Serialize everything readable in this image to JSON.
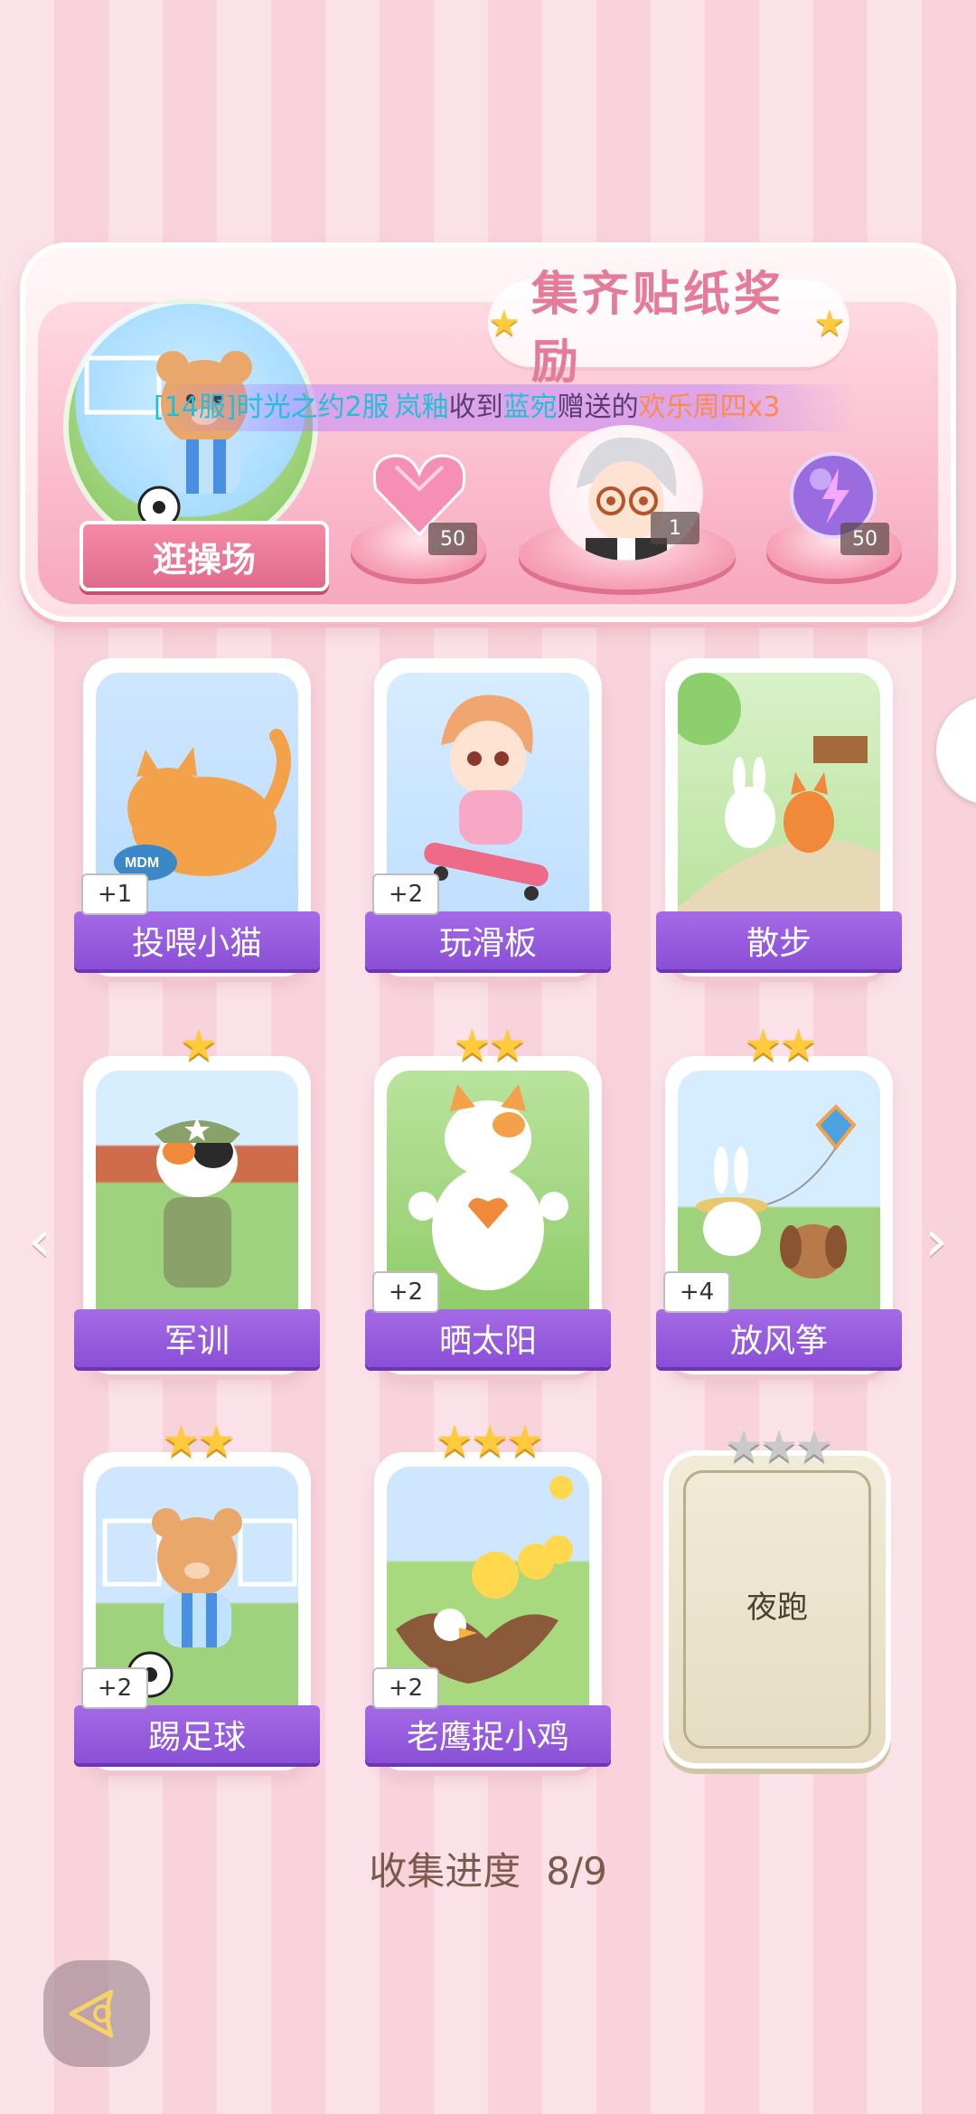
{
  "reward_panel": {
    "title": "集齐贴纸奖励",
    "location_label": "逛操场",
    "ticker": {
      "part1": "[14服]时光之约2服",
      "part2": "岚釉",
      "part3": "收到",
      "part4": "蓝宛",
      "part5": "赠送的",
      "part6": "欢乐周四x3"
    },
    "rewards": [
      {
        "icon": "pink-heart-gem-icon",
        "count": "50"
      },
      {
        "icon": "character-avatar",
        "count": "1"
      },
      {
        "icon": "purple-energy-orb-icon",
        "count": "50"
      }
    ]
  },
  "stickers": [
    {
      "label": "投喂小猫",
      "bonus": "+1",
      "stars": 0,
      "unlocked": true
    },
    {
      "label": "玩滑板",
      "bonus": "+2",
      "stars": 0,
      "unlocked": true
    },
    {
      "label": "散步",
      "bonus": "",
      "stars": 0,
      "unlocked": true
    },
    {
      "label": "军训",
      "bonus": "",
      "stars": 1,
      "unlocked": true
    },
    {
      "label": "晒太阳",
      "bonus": "+2",
      "stars": 2,
      "unlocked": true
    },
    {
      "label": "放风筝",
      "bonus": "+4",
      "stars": 2,
      "unlocked": true
    },
    {
      "label": "踢足球",
      "bonus": "+2",
      "stars": 2,
      "unlocked": true
    },
    {
      "label": "老鹰捉小鸡",
      "bonus": "+2",
      "stars": 3,
      "unlocked": true
    },
    {
      "label": "夜跑",
      "bonus": "",
      "stars": 3,
      "unlocked": false
    }
  ],
  "progress": {
    "label": "收集进度",
    "value": "8/9"
  },
  "nav": {
    "prev": "‹",
    "next": "›"
  },
  "colors": {
    "accent_purple": "#8a4fd6",
    "pink": "#f48aa6",
    "star_gold": "#ffcb3d"
  }
}
